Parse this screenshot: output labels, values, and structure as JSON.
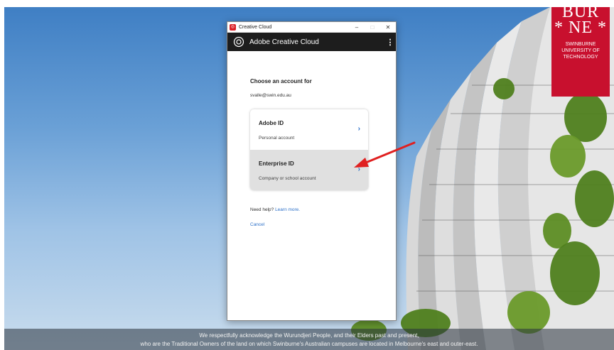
{
  "window": {
    "title": "Creative Cloud",
    "minimize": "–",
    "maximize": "□",
    "close": "✕"
  },
  "header": {
    "title": "Adobe Creative Cloud",
    "menu": "⋮"
  },
  "content": {
    "heading": "Choose an account for",
    "email": "svalle@swin.edu.au",
    "accounts": [
      {
        "title": "Adobe ID",
        "subtitle": "Personal account",
        "chevron": "›"
      },
      {
        "title": "Enterprise ID",
        "subtitle": "Company or school account",
        "chevron": "›"
      }
    ],
    "help_text": "Need help?",
    "help_link": "Learn more.",
    "cancel": "Cancel"
  },
  "logo": {
    "line1": "BUR",
    "line2": "* NE *",
    "line3": "SWINBURNE",
    "line4": "UNIVERSITY OF",
    "line5": "TECHNOLOGY"
  },
  "acknowledgement": {
    "line1": "We respectfully acknowledge the Wurundjeri People, and their Elders past and present,",
    "line2": "who are the Traditional Owners of the land on which Swinburne's Australian campuses are located in Melbourne's east and outer-east."
  },
  "colors": {
    "accent_red": "#c8102e",
    "link_blue": "#2d71c9",
    "header_dark": "#1d1d1d",
    "annotation_arrow": "#e02020"
  }
}
